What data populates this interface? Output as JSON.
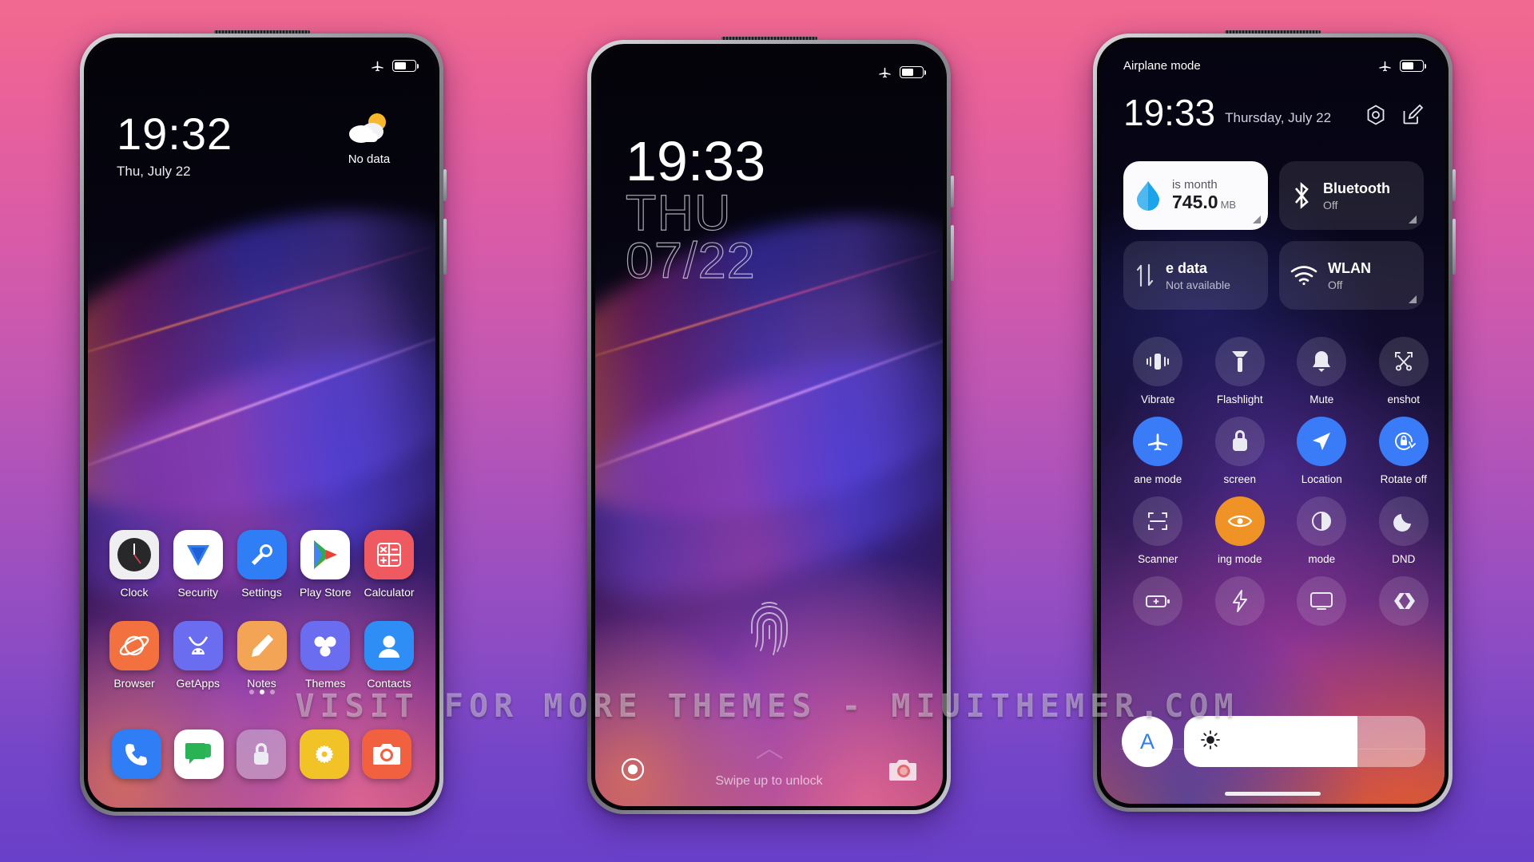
{
  "watermark": {
    "text": "VISIT FOR MORE THEMES - MIUITHEMER.COM"
  },
  "background": {
    "top_color": "#f2698f",
    "bottom_color": "#6940c9"
  },
  "phone_home": {
    "statusbar": {
      "airplane_icon": "airplane-icon",
      "battery_icon": "battery-icon",
      "battery_level": "60"
    },
    "clock": {
      "time": "19:32",
      "date": "Thu, July 22"
    },
    "weather": {
      "icon": "partly-cloudy-icon",
      "label": "No data"
    },
    "apps_row1": [
      {
        "label": "Clock",
        "icon": "clock-app-icon",
        "bg": "#efeff2"
      },
      {
        "label": "Security",
        "icon": "security-shield-icon",
        "bg": "#ffffff"
      },
      {
        "label": "Settings",
        "icon": "settings-wrench-icon",
        "bg": "#2f7ef5"
      },
      {
        "label": "Play Store",
        "icon": "play-store-icon",
        "bg": "#ffffff"
      },
      {
        "label": "Calculator",
        "icon": "calculator-icon",
        "bg": "#ef5a61"
      }
    ],
    "apps_row2": [
      {
        "label": "Browser",
        "icon": "browser-planet-icon",
        "bg": "#f2713f"
      },
      {
        "label": "GetApps",
        "icon": "getapps-android-bag-icon",
        "bg": "#6b6df0"
      },
      {
        "label": "Notes",
        "icon": "notes-pencil-icon",
        "bg": "#f3a455"
      },
      {
        "label": "Themes",
        "icon": "themes-clover-icon",
        "bg": "#6b6df0"
      },
      {
        "label": "Contacts",
        "icon": "contacts-person-icon",
        "bg": "#2f8ef5"
      }
    ],
    "dock": [
      {
        "label": "Phone",
        "icon": "phone-handset-icon",
        "bg": "#2f7ef5"
      },
      {
        "label": "Messages",
        "icon": "messages-bubble-icon",
        "bg": "#ffffff"
      },
      {
        "label": "Lock",
        "icon": "lock-padlock-icon",
        "bg": "rgba(200,190,215,0.55)"
      },
      {
        "label": "Gallery",
        "icon": "gallery-flower-icon",
        "bg": "#f2c327"
      },
      {
        "label": "Camera",
        "icon": "camera-lens-icon",
        "bg": "#f1603f"
      }
    ],
    "page_dots": {
      "count": 3,
      "active_index": 1
    }
  },
  "phone_lock": {
    "statusbar": {
      "airplane_icon": "airplane-icon",
      "battery_icon": "battery-icon",
      "battery_level": "60"
    },
    "clock": {
      "time": "19:33",
      "day_of_week": "THU",
      "date": "07/22"
    },
    "fingerprint_icon": "fingerprint-icon",
    "swipe_hint": "Swipe up to unlock",
    "left_icon": "flashlight-circle-icon",
    "right_icon": "camera-icon",
    "chevron_icon": "chevron-up-icon"
  },
  "phone_control_center": {
    "statusbar": {
      "label": "Airplane mode",
      "airplane_icon": "airplane-icon",
      "battery_icon": "battery-icon",
      "battery_level": "60"
    },
    "header": {
      "time": "19:33",
      "date": "Thursday, July 22",
      "settings_icon": "settings-gear-icon",
      "edit_icon": "edit-pencil-icon"
    },
    "big_tiles": [
      {
        "name": "data-usage",
        "icon": "data-drop-icon",
        "label": "is month",
        "value": "745.0",
        "unit": "MB",
        "active": true
      },
      {
        "name": "bluetooth",
        "icon": "bluetooth-icon",
        "title": "Bluetooth",
        "sub": "Off",
        "active": false
      },
      {
        "name": "mobile-data",
        "icon": "mobile-data-arrows-icon",
        "title": "e data",
        "sub": "Not available",
        "active": false
      },
      {
        "name": "wlan",
        "icon": "wifi-icon",
        "title": "WLAN",
        "sub": "Off",
        "active": false
      }
    ],
    "toggles": [
      {
        "label": "Vibrate",
        "icon": "vibrate-icon",
        "state": "off"
      },
      {
        "label": "Flashlight",
        "icon": "flashlight-icon",
        "state": "off"
      },
      {
        "label": "Mute",
        "icon": "bell-mute-icon",
        "state": "off"
      },
      {
        "label": "enshot",
        "icon": "screenshot-scissors-icon",
        "state": "off"
      },
      {
        "label": "ane mode",
        "icon": "airplane-icon",
        "state": "on"
      },
      {
        "label": "screen",
        "icon": "lock-screen-icon",
        "state": "off"
      },
      {
        "label": "Location",
        "icon": "location-arrow-icon",
        "state": "on"
      },
      {
        "label": "Rotate off",
        "icon": "rotate-lock-icon",
        "state": "on"
      },
      {
        "label": "Scanner",
        "icon": "scanner-frame-icon",
        "state": "off"
      },
      {
        "label": "ing mode",
        "icon": "reading-mode-eye-icon",
        "state": "orange"
      },
      {
        "label": "mode",
        "icon": "dark-mode-contrast-icon",
        "state": "off"
      },
      {
        "label": "DND",
        "icon": "dnd-moon-icon",
        "state": "off"
      },
      {
        "label": "",
        "icon": "battery-saver-icon",
        "state": "off"
      },
      {
        "label": "",
        "icon": "power-bolt-icon",
        "state": "off"
      },
      {
        "label": "",
        "icon": "cast-screen-icon",
        "state": "off"
      },
      {
        "label": "",
        "icon": "second-space-icon",
        "state": "off"
      }
    ],
    "brightness": {
      "auto_label": "A",
      "auto_name": "auto-brightness-button",
      "slider_icon": "brightness-sun-icon",
      "fill_percent": 72
    }
  }
}
